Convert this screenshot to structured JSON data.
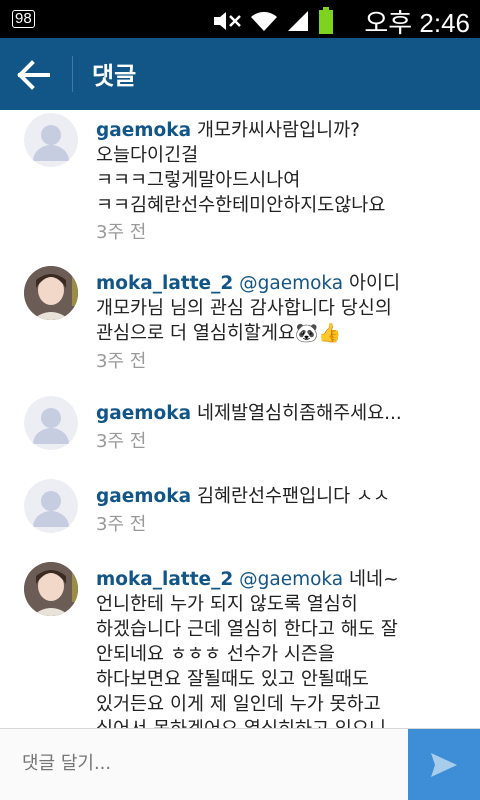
{
  "status_bar": {
    "notification": "98",
    "time": "오후 2:46",
    "icons": [
      "mute-icon",
      "wifi-icon",
      "signal-icon",
      "battery-icon"
    ]
  },
  "app_bar": {
    "title": "댓글",
    "colors": {
      "bar": "#125688",
      "send": "#3d8ed6"
    }
  },
  "comments": [
    {
      "username": "gaemoka",
      "mention": "",
      "text": "개모카씨사람입니까?",
      "lines": [
        "오늘다이긴걸",
        "ㅋㅋㅋ그렇게말아드시나여",
        "ㅋㅋ김혜란선수한테미안하지도않나요"
      ],
      "time": "3주 전",
      "avatar": "default-avatar"
    },
    {
      "username": "moka_latte_2",
      "mention": "@gaemoka",
      "text": "아이디",
      "lines": [
        "개모카님 님의 관심 감사합니다 당신의",
        "관심으로 더 열심히할게요🐼👍"
      ],
      "time": "3주 전",
      "avatar": "profile-photo"
    },
    {
      "username": "gaemoka",
      "mention": "",
      "text": "네제발열심히좀해주세요...",
      "lines": [],
      "time": "3주 전",
      "avatar": "default-avatar"
    },
    {
      "username": "gaemoka",
      "mention": "",
      "text": "김혜란선수팬입니다 ㅅㅅ",
      "lines": [],
      "time": "3주 전",
      "avatar": "default-avatar"
    },
    {
      "username": "moka_latte_2",
      "mention": "@gaemoka",
      "text": "네네~",
      "lines": [
        "언니한테 누가 되지 않도록 열심히",
        "하겠습니다 근데 열심히 한다고 해도 잘",
        "안되네요 ㅎㅎㅎ 선수가 시즌을",
        "하다보면요 잘될때도 있고 안될때도",
        "있거든요 이게 제 일인데 누가 못하고",
        "싶어서 못하겠어요 열심히하고 있으니"
      ],
      "time": "",
      "avatar": "profile-photo"
    }
  ],
  "input": {
    "placeholder": "댓글 달기..."
  }
}
